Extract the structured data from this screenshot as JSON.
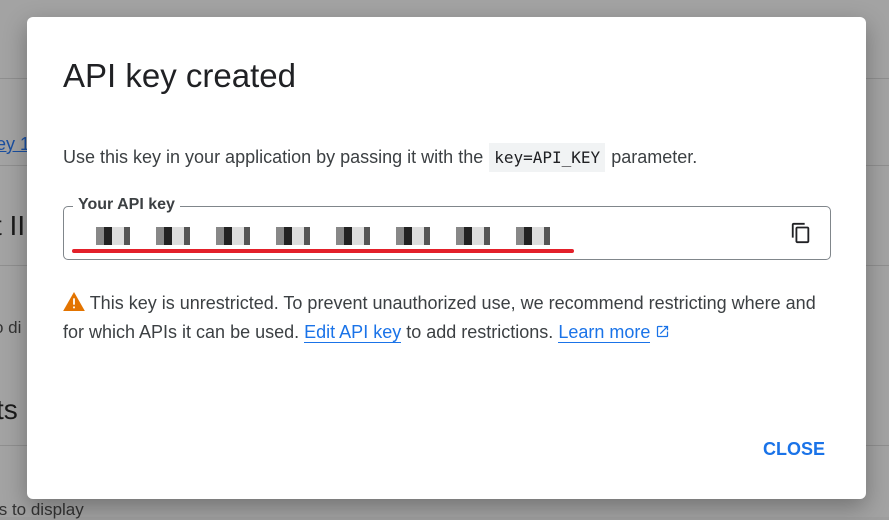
{
  "background": {
    "fragments": [
      "ey 1",
      "t II",
      "o di",
      "ts",
      "ts to display"
    ]
  },
  "dialog": {
    "title": "API key created",
    "description_before": "Use this key in your application by passing it with the",
    "description_code": "key=API_KEY",
    "description_after": "parameter.",
    "field_label": "Your API key",
    "copy_icon": "content-copy-icon",
    "warning_icon": "warning-triangle-icon",
    "warning_text": "This key is unrestricted. To prevent unauthorized use, we recommend restricting where and for which APIs it can be used.",
    "edit_link": "Edit API key",
    "middle_text": "to add restrictions.",
    "learn_more": "Learn more",
    "close_label": "CLOSE"
  },
  "colors": {
    "accent": "#1a73e8",
    "warning": "#e37400",
    "highlight": "#e3202a"
  }
}
